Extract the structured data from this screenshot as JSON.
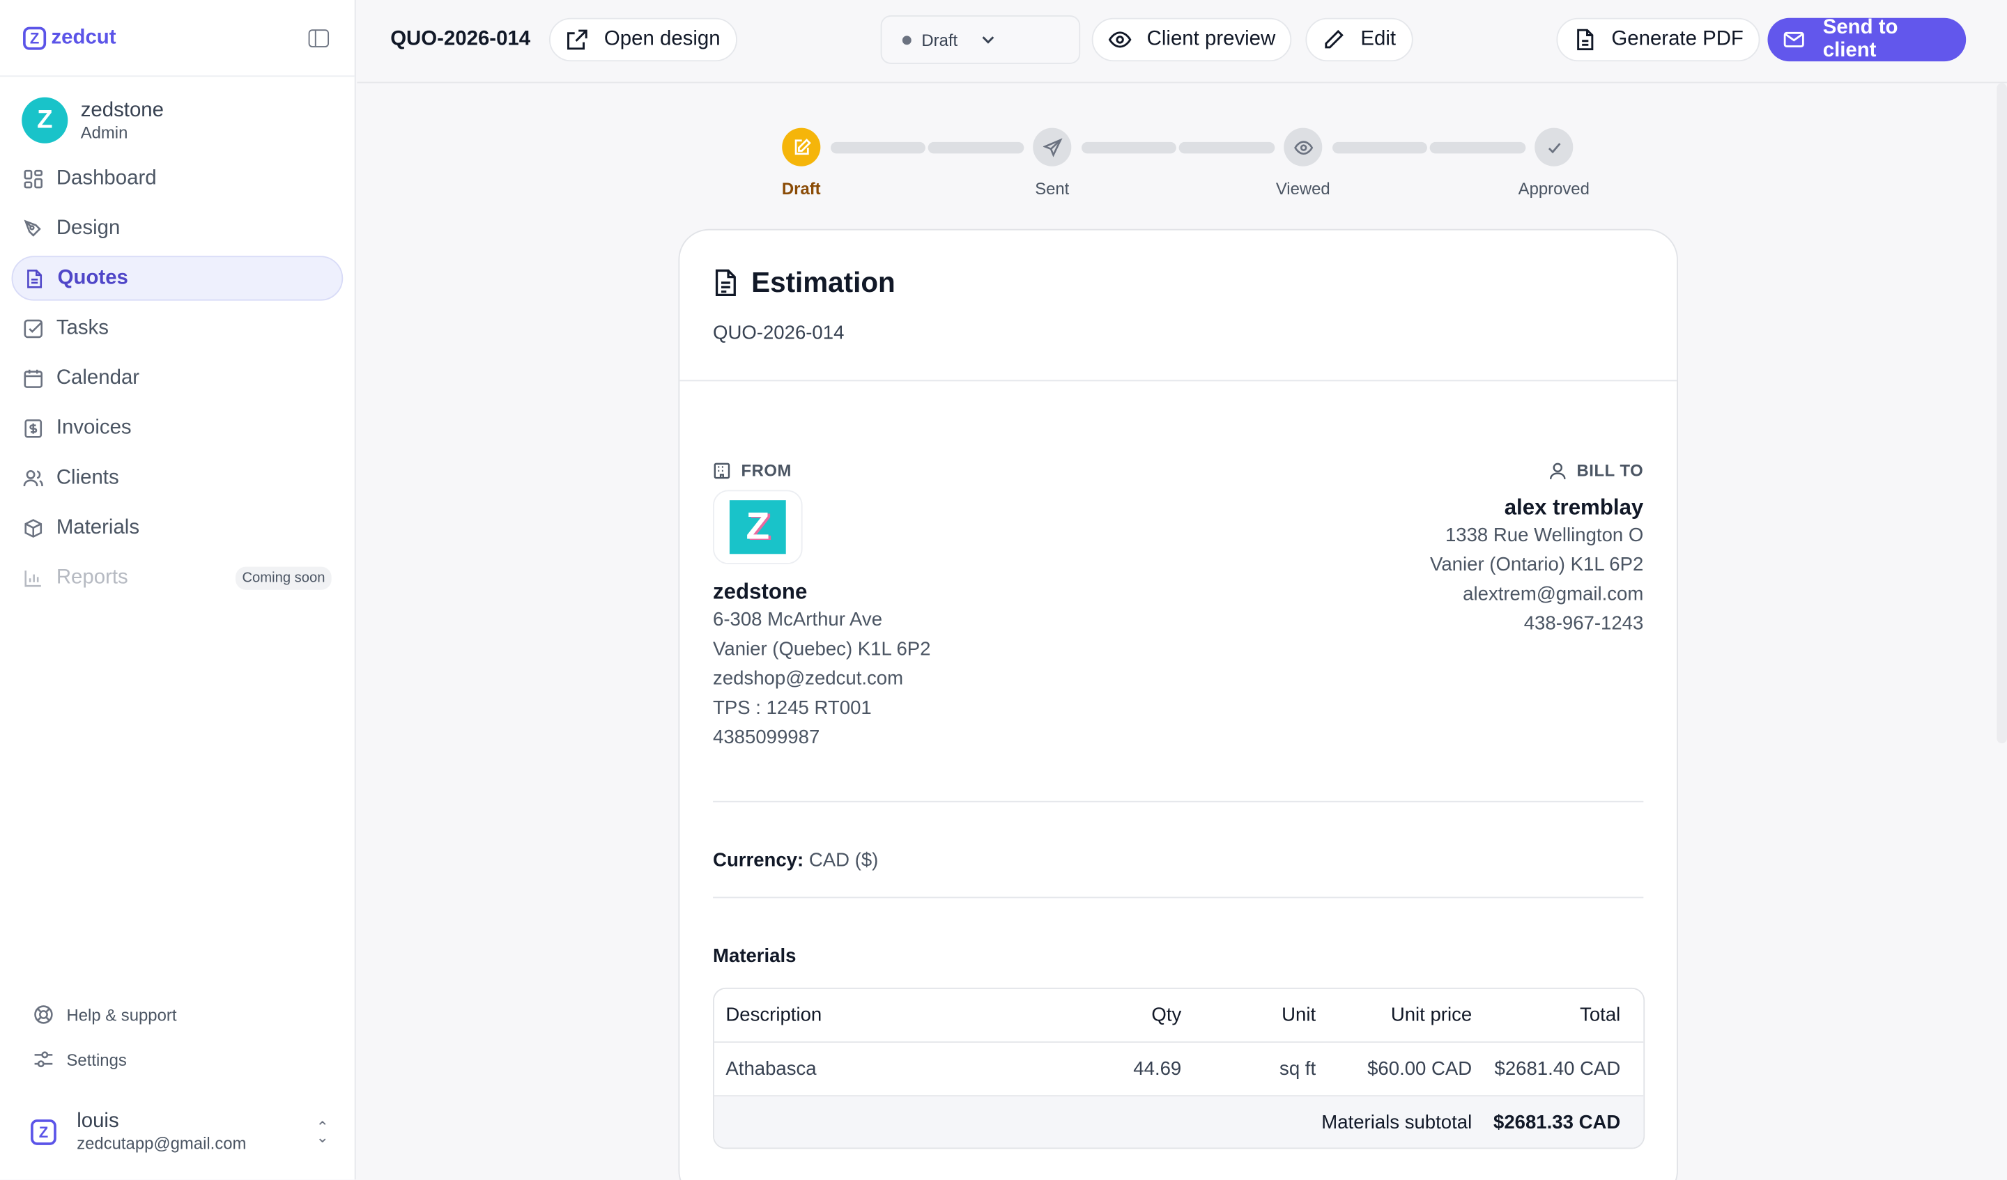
{
  "brand": {
    "name": "zedcut",
    "mark": "Z"
  },
  "user": {
    "initial": "Z",
    "name": "zedstone",
    "role": "Admin"
  },
  "nav": [
    {
      "label": "Dashboard",
      "icon": "dashboard-icon"
    },
    {
      "label": "Design",
      "icon": "pen-tool-icon"
    },
    {
      "label": "Quotes",
      "icon": "document-icon",
      "active": true
    },
    {
      "label": "Tasks",
      "icon": "check-square-icon"
    },
    {
      "label": "Calendar",
      "icon": "calendar-icon"
    },
    {
      "label": "Invoices",
      "icon": "dollar-receipt-icon"
    },
    {
      "label": "Clients",
      "icon": "users-icon"
    },
    {
      "label": "Materials",
      "icon": "box-icon"
    },
    {
      "label": "Reports",
      "icon": "bar-chart-icon",
      "disabled": true,
      "badge": "Coming soon"
    }
  ],
  "footer": {
    "help": "Help & support",
    "settings": "Settings"
  },
  "account": {
    "name": "louis",
    "email": "zedcutapp@gmail.com"
  },
  "topbar": {
    "quote_id": "QUO-2026-014",
    "open_design": "Open design",
    "status": "Draft",
    "client_preview": "Client preview",
    "edit": "Edit",
    "generate_pdf": "Generate PDF",
    "send": "Send to client"
  },
  "stepper": {
    "current": "Draft",
    "steps": [
      "Draft",
      "Sent",
      "Viewed",
      "Approved"
    ]
  },
  "quote": {
    "title": "Estimation",
    "number": "QUO-2026-014",
    "from_label": "FROM",
    "bill_to_label": "BILL TO",
    "from": {
      "logo_letter": "Z",
      "company": "zedstone",
      "lines": [
        "6-308 McArthur Ave",
        "Vanier (Quebec) K1L 6P2",
        "zedshop@zedcut.com",
        "TPS : 1245 RT001",
        "4385099987"
      ]
    },
    "bill_to": {
      "name": "alex tremblay",
      "lines": [
        "1338 Rue Wellington O",
        "Vanier (Ontario) K1L 6P2",
        "alextrem@gmail.com",
        "438-967-1243"
      ]
    },
    "currency_label": "Currency:",
    "currency_value": "CAD ($)",
    "materials_title": "Materials",
    "table": {
      "headers": [
        "Description",
        "Qty",
        "Unit",
        "Unit price",
        "Total"
      ],
      "rows": [
        {
          "description": "Athabasca",
          "qty": "44.69",
          "unit": "sq ft",
          "unit_price": "$60.00 CAD",
          "total": "$2681.40 CAD"
        }
      ],
      "subtotal_label": "Materials subtotal",
      "subtotal_value": "$2681.33 CAD"
    }
  },
  "colors": {
    "accent": "#6257ec",
    "draft": "#f5b50a",
    "brand_teal": "#19c3c9"
  }
}
